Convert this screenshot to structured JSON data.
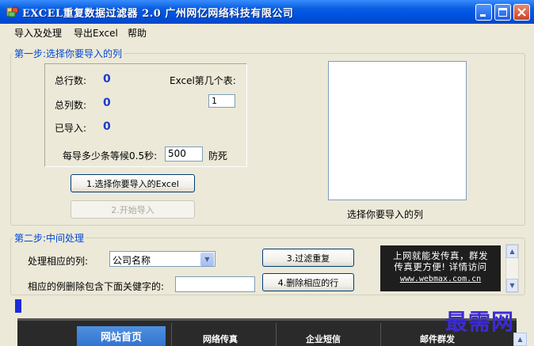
{
  "window": {
    "title": "EXCEL重复数据过滤器 2.0    广州网亿网络科技有限公司"
  },
  "menu": {
    "items": [
      "导入及处理",
      "导出Excel",
      "帮助"
    ]
  },
  "step1": {
    "title": "第一步:选择你要导入的列",
    "total_rows_label": "总行数:",
    "total_rows_value": "0",
    "total_cols_label": "总列数:",
    "total_cols_value": "0",
    "imported_label": "已导入:",
    "imported_value": "0",
    "sheet_label": "Excel第几个表:",
    "sheet_value": "1",
    "batch_label": "每导多少条等候0.5秒:",
    "batch_value": "500",
    "batch_suffix": "防死",
    "select_excel_button": "1.选择你要导入的Excel",
    "start_import_button": "2.开始导入",
    "column_list_caption": "选择你要导入的列"
  },
  "step2": {
    "title": "第二步:中间处理",
    "column_label": "处理相应的列:",
    "column_select_value": "公司名称",
    "delete_label": "相应的例删除包含下面关健字的:",
    "delete_keyword_value": "",
    "filter_button": "3.过滤重复",
    "delete_button": "4.删除相应的行"
  },
  "ad": {
    "line1": "上网就能发传真，群发",
    "line2": "传真更方便! 详情访问",
    "url": "www.webmax.com.cn"
  },
  "progress": {
    "fraction": 0.012
  },
  "web_nav": {
    "items": [
      "网站首页",
      "网络传真",
      "企业短信",
      "邮件群发"
    ]
  },
  "watermark": "最需网",
  "colors": {
    "titlebar": "#0054e3",
    "group_title": "#0046d5",
    "value_text": "#1a3ccc",
    "progress": "#1c2bd9"
  }
}
